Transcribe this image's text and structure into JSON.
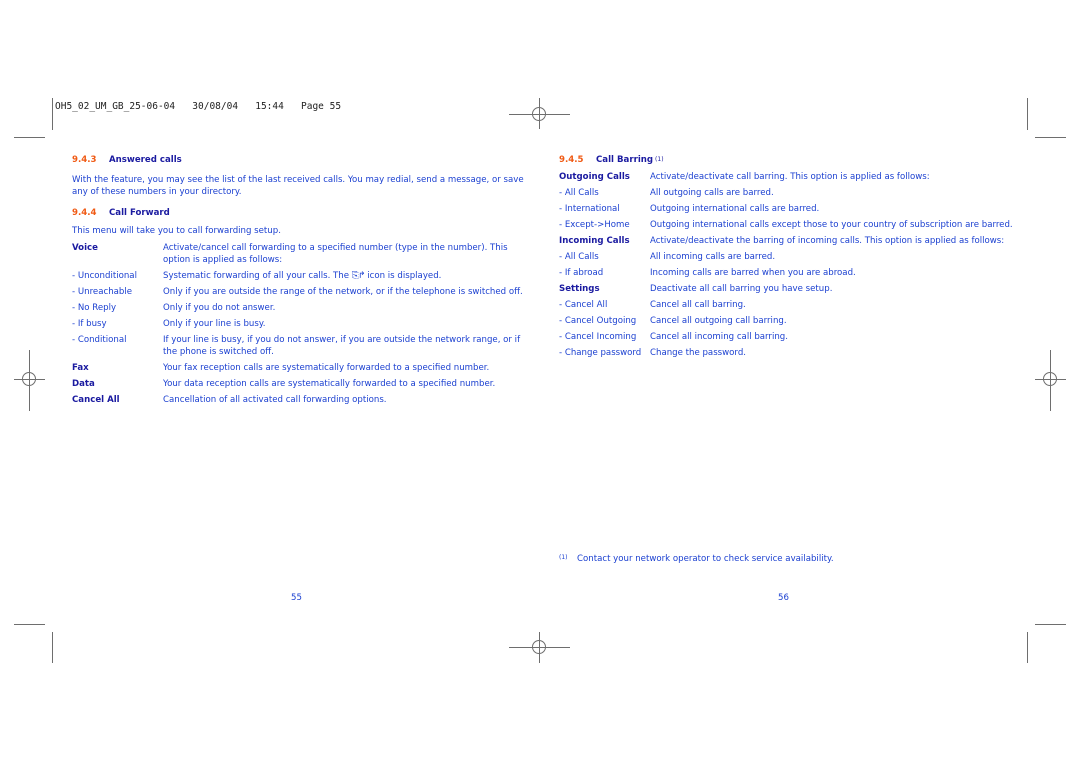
{
  "slug": {
    "file": "OH5_02_UM_GB_25-06-04",
    "date": "30/08/04",
    "time": "15:44",
    "page_label": "Page 55"
  },
  "left_page": {
    "answered_calls": {
      "number": "9.4.3",
      "title": "Answered calls",
      "text": "With the feature, you may see the list of the last received calls. You may redial, send a message, or save any of these numbers in your directory."
    },
    "call_forward": {
      "number": "9.4.4",
      "title": "Call Forward",
      "intro": "This menu will take you to call forwarding setup.",
      "rows": [
        {
          "term": "Voice",
          "bold": true,
          "desc": "Activate/cancel call forwarding to a specified number (type in the number). This option is applied as follows:"
        },
        {
          "term": "- Unconditional",
          "bold": false,
          "desc_before": "Systematic forwarding of all your calls. The",
          "icon": "call-forward-icon",
          "desc_after": "icon is displayed."
        },
        {
          "term": "- Unreachable",
          "bold": false,
          "desc": "Only if you are outside the range of the network, or if the telephone is switched off."
        },
        {
          "term": "- No Reply",
          "bold": false,
          "desc": "Only if you do not answer."
        },
        {
          "term": "- If busy",
          "bold": false,
          "desc": "Only if your line is busy."
        },
        {
          "term": "- Conditional",
          "bold": false,
          "desc": "If your line is busy, if you do not answer, if you are outside the network range, or if the phone is switched off."
        },
        {
          "term": "Fax",
          "bold": true,
          "desc": "Your fax reception calls are systematically forwarded to a specified number."
        },
        {
          "term": "Data",
          "bold": true,
          "desc": "Your data reception calls are systematically forwarded to a specified number."
        },
        {
          "term": "Cancel All",
          "bold": true,
          "desc": "Cancellation of all activated call forwarding options."
        }
      ]
    },
    "page_number": "55"
  },
  "right_page": {
    "call_barring": {
      "number": "9.4.5",
      "title": "Call Barring",
      "footnote_ref": "(1)",
      "rows": [
        {
          "term": "Outgoing Calls",
          "bold": true,
          "desc": "Activate/deactivate call barring. This option is applied as follows:"
        },
        {
          "term": "- All Calls",
          "bold": false,
          "desc": "All outgoing calls are barred."
        },
        {
          "term": "- International",
          "bold": false,
          "desc": "Outgoing international calls are barred."
        },
        {
          "term": "- Except->Home",
          "bold": false,
          "desc": "Outgoing international calls except those to your country of subscription are barred."
        },
        {
          "term": "Incoming Calls",
          "bold": true,
          "desc": "Activate/deactivate the barring of incoming calls. This option is applied as follows:"
        },
        {
          "term": "- All Calls",
          "bold": false,
          "desc": "All incoming calls are barred."
        },
        {
          "term": "- If abroad",
          "bold": false,
          "desc": "Incoming calls are barred when you are abroad."
        },
        {
          "term": "Settings",
          "bold": true,
          "desc": "Deactivate all call barring you have setup."
        },
        {
          "term": "- Cancel All",
          "bold": false,
          "desc": "Cancel all call barring."
        },
        {
          "term": "- Cancel Outgoing",
          "bold": false,
          "desc": "Cancel all outgoing call barring."
        },
        {
          "term": "- Cancel Incoming",
          "bold": false,
          "desc": "Cancel all incoming call barring."
        },
        {
          "term": "- Change password",
          "bold": false,
          "desc": "Change the password."
        }
      ]
    },
    "footnote": {
      "mark": "(1)",
      "text": "Contact your network operator to check service availability."
    },
    "page_number": "56"
  },
  "colors": {
    "section_number": "#f05a14",
    "heading": "#1a1aa0",
    "body_text": "#1a3fd0",
    "crop_marks": "#6e6e6e"
  }
}
